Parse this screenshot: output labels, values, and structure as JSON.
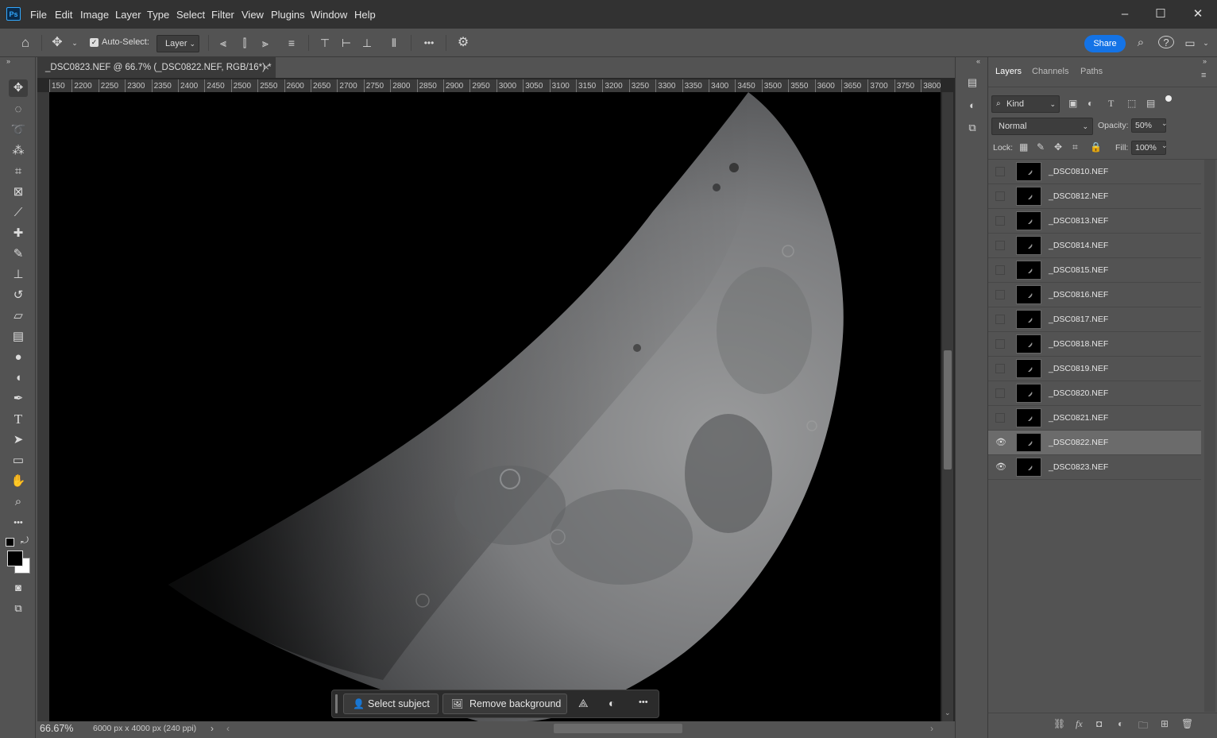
{
  "app": {
    "logo_text": "Ps"
  },
  "menu": {
    "items": [
      "File",
      "Edit",
      "Image",
      "Layer",
      "Type",
      "Select",
      "Filter",
      "View",
      "Plugins",
      "Window",
      "Help"
    ]
  },
  "window_controls": {
    "minimize": "–",
    "maximize": "☐",
    "close": "✕"
  },
  "options_bar": {
    "auto_select_label": "Auto-Select:",
    "auto_select_checked": true,
    "target_value": "Layer",
    "share_label": "Share"
  },
  "document": {
    "tab_title": "_DSC0823.NEF @ 66.7% (_DSC0822.NEF, RGB/16*) *",
    "close_glyph": "×",
    "ruler_ticks": [
      "150",
      "2200",
      "2250",
      "2300",
      "2350",
      "2400",
      "2450",
      "2500",
      "2550",
      "2600",
      "2650",
      "2700",
      "2750",
      "2800",
      "2850",
      "2900",
      "2950",
      "3000",
      "3050",
      "3100",
      "3150",
      "3200",
      "3250",
      "3300",
      "3350",
      "3400",
      "3450",
      "3500",
      "3550",
      "3600",
      "3650",
      "3700",
      "3750",
      "3800"
    ],
    "zoom": "66.67%",
    "doc_info": "6000 px x 4000 px (240 ppi)"
  },
  "contextual_bar": {
    "select_subject": "Select subject",
    "remove_background": "Remove background",
    "more": "•••"
  },
  "layers_panel": {
    "tabs": [
      "Layers",
      "Channels",
      "Paths"
    ],
    "active_tab": "Layers",
    "filter_kind": "Kind",
    "blend_mode": "Normal",
    "opacity_label": "Opacity:",
    "opacity_value": "50%",
    "lock_label": "Lock:",
    "fill_label": "Fill:",
    "fill_value": "100%",
    "layers": [
      {
        "name": "_DSC0810.NEF",
        "visible": false,
        "selected": false
      },
      {
        "name": "_DSC0812.NEF",
        "visible": false,
        "selected": false
      },
      {
        "name": "_DSC0813.NEF",
        "visible": false,
        "selected": false
      },
      {
        "name": "_DSC0814.NEF",
        "visible": false,
        "selected": false
      },
      {
        "name": "_DSC0815.NEF",
        "visible": false,
        "selected": false
      },
      {
        "name": "_DSC0816.NEF",
        "visible": false,
        "selected": false
      },
      {
        "name": "_DSC0817.NEF",
        "visible": false,
        "selected": false
      },
      {
        "name": "_DSC0818.NEF",
        "visible": false,
        "selected": false
      },
      {
        "name": "_DSC0819.NEF",
        "visible": false,
        "selected": false
      },
      {
        "name": "_DSC0820.NEF",
        "visible": false,
        "selected": false
      },
      {
        "name": "_DSC0821.NEF",
        "visible": false,
        "selected": false
      },
      {
        "name": "_DSC0822.NEF",
        "visible": true,
        "selected": true
      },
      {
        "name": "_DSC0823.NEF",
        "visible": true,
        "selected": false
      }
    ]
  },
  "colors": {
    "accent": "#1473e6",
    "canvas": "#000000",
    "panel": "#535353",
    "bar": "#323232"
  }
}
